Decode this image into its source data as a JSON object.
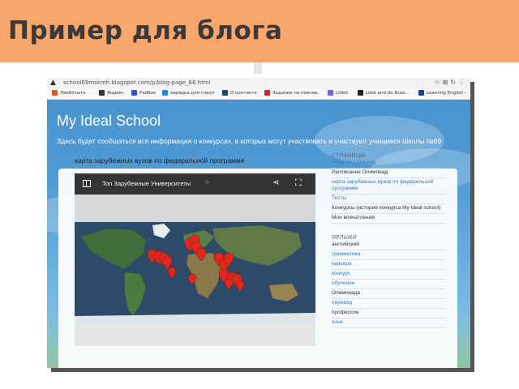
{
  "slide": {
    "title": "Пример для блога",
    "header_color": "#f7a66c"
  },
  "browser": {
    "url": "school69mskmh.blogspot.com/p/blog-page_68.html",
    "bookmarks": [
      {
        "label": "Лекботыть",
        "color": "#e05a1b"
      },
      {
        "label": "Яндекс",
        "color": "#333333"
      },
      {
        "label": "Рэйбзи",
        "color": "#3355cc"
      },
      {
        "label": "зарядка для глаз(г",
        "color": "#1e88e5"
      },
      {
        "label": "О контакте",
        "color": "#20466e"
      },
      {
        "label": "Задание на повсев..",
        "color": "#c62828"
      },
      {
        "label": "LiVed",
        "color": "#7b5ecf"
      },
      {
        "label": "Look and do Nuss..",
        "color": "#222222"
      },
      {
        "label": "Learning English -",
        "color": "#1c3f94"
      }
    ]
  },
  "blog": {
    "title": "My Ideal School",
    "description": "Здесь будет сообщаться вся информация о конкурсах, в которых могут участвовать и участвуют учащиеся Школы №69",
    "post_title": "карта зарубежных вузов по федеральной программе"
  },
  "map": {
    "title": "Топ Зарубежные Университеты",
    "star": "☆",
    "share_icon": "share-icon",
    "fullscreen_icon": "fullscreen-icon",
    "pin_color": "#e0281e",
    "land_color": "#3f6e3a",
    "ocean_color": "#2d4a68"
  },
  "sidebar": {
    "pages_heading": "СТРАНИЦЫ",
    "pages": [
      {
        "label": "Главная страница",
        "active": true
      },
      {
        "label": "Расписание Олимпиад",
        "active": false
      },
      {
        "label": "карта зарубежных вузов по федеральной программе",
        "active": true
      },
      {
        "label": "Тесты",
        "active": true
      },
      {
        "label": "Конкурсы (история конкурса My Ideal school)",
        "active": false
      },
      {
        "label": "Мои впечатления",
        "active": false
      }
    ],
    "labels_heading": "ЯРЛЫКИ",
    "labels": [
      {
        "label": "английский",
        "active": false
      },
      {
        "label": "грамматика",
        "active": true
      },
      {
        "label": "карьера",
        "active": true
      },
      {
        "label": "конкурс",
        "active": true
      },
      {
        "label": "обучение",
        "active": true
      },
      {
        "label": "Олимпиада",
        "active": false
      },
      {
        "label": "перевод",
        "active": true
      },
      {
        "label": "профессия",
        "active": false
      },
      {
        "label": "язык",
        "active": true
      }
    ]
  }
}
